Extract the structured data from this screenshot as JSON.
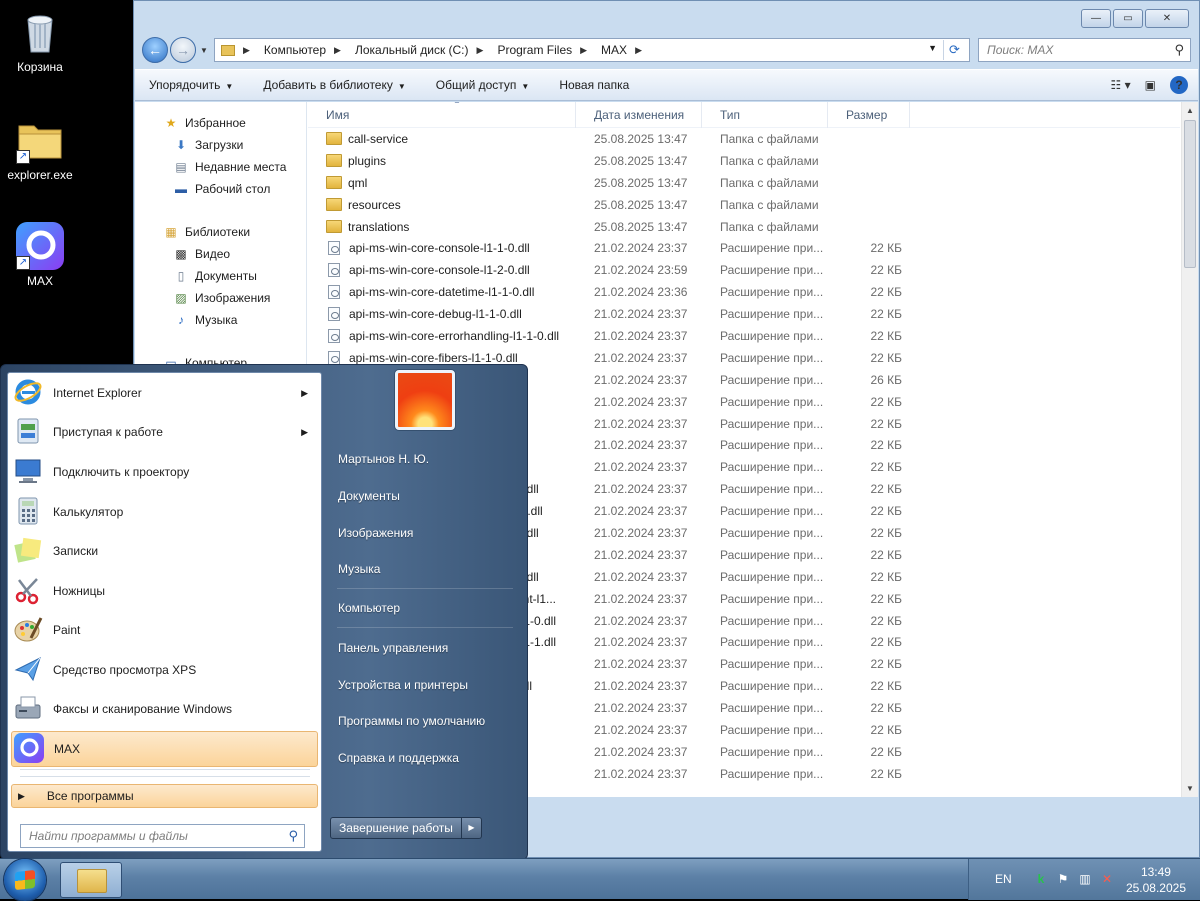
{
  "desktop": {
    "icons": [
      {
        "label": "Корзина"
      },
      {
        "label": "explorer.exe"
      },
      {
        "label": "MAX"
      }
    ]
  },
  "explorer": {
    "caption_buttons": {
      "minimize": "—",
      "maximize": "▭",
      "close": "✕"
    },
    "breadcrumb": [
      "Компьютер",
      "Локальный диск (C:)",
      "Program Files",
      "MAX"
    ],
    "search_placeholder": "Поиск: MAX",
    "toolbar": {
      "organize": "Упорядочить",
      "add_to_library": "Добавить в библиотеку",
      "share": "Общий доступ",
      "new_folder": "Новая папка"
    },
    "nav": {
      "favorites": "Избранное",
      "downloads": "Загрузки",
      "recent": "Недавние места",
      "desktop": "Рабочий стол",
      "libraries": "Библиотеки",
      "video": "Видео",
      "documents": "Документы",
      "pictures": "Изображения",
      "music": "Музыка",
      "computer": "Компьютер"
    },
    "columns": {
      "name": "Имя",
      "date": "Дата изменения",
      "type": "Тип",
      "size": "Размер"
    },
    "files": [
      {
        "name": "call-service",
        "date": "25.08.2025 13:47",
        "type": "Папка с файлами",
        "size": "",
        "kind": "folder"
      },
      {
        "name": "plugins",
        "date": "25.08.2025 13:47",
        "type": "Папка с файлами",
        "size": "",
        "kind": "folder"
      },
      {
        "name": "qml",
        "date": "25.08.2025 13:47",
        "type": "Папка с файлами",
        "size": "",
        "kind": "folder"
      },
      {
        "name": "resources",
        "date": "25.08.2025 13:47",
        "type": "Папка с файлами",
        "size": "",
        "kind": "folder"
      },
      {
        "name": "translations",
        "date": "25.08.2025 13:47",
        "type": "Папка с файлами",
        "size": "",
        "kind": "folder"
      },
      {
        "name": "api-ms-win-core-console-l1-1-0.dll",
        "date": "21.02.2024 23:37",
        "type": "Расширение при...",
        "size": "22 КБ",
        "kind": "dll"
      },
      {
        "name": "api-ms-win-core-console-l1-2-0.dll",
        "date": "21.02.2024 23:59",
        "type": "Расширение при...",
        "size": "22 КБ",
        "kind": "dll"
      },
      {
        "name": "api-ms-win-core-datetime-l1-1-0.dll",
        "date": "21.02.2024 23:36",
        "type": "Расширение при...",
        "size": "22 КБ",
        "kind": "dll"
      },
      {
        "name": "api-ms-win-core-debug-l1-1-0.dll",
        "date": "21.02.2024 23:37",
        "type": "Расширение при...",
        "size": "22 КБ",
        "kind": "dll"
      },
      {
        "name": "api-ms-win-core-errorhandling-l1-1-0.dll",
        "date": "21.02.2024 23:37",
        "type": "Расширение при...",
        "size": "22 КБ",
        "kind": "dll"
      },
      {
        "name": "api-ms-win-core-fibers-l1-1-0.dll",
        "date": "21.02.2024 23:37",
        "type": "Расширение при...",
        "size": "22 КБ",
        "kind": "dll"
      },
      {
        "name": "",
        "date": "21.02.2024 23:37",
        "type": "Расширение при...",
        "size": "26 КБ",
        "kind": "hidden"
      },
      {
        "name": "",
        "date": "21.02.2024 23:37",
        "type": "Расширение при...",
        "size": "22 КБ",
        "kind": "hidden"
      },
      {
        "name": "",
        "date": "21.02.2024 23:37",
        "type": "Расширение при...",
        "size": "22 КБ",
        "kind": "hidden"
      },
      {
        "name": "dll",
        "date": "21.02.2024 23:37",
        "type": "Расширение при...",
        "size": "22 КБ",
        "kind": "hidden"
      },
      {
        "name": "",
        "date": "21.02.2024 23:37",
        "type": "Расширение при...",
        "size": "22 КБ",
        "kind": "hidden"
      },
      {
        "name": "1-0.dll",
        "date": "21.02.2024 23:37",
        "type": "Расширение при...",
        "size": "22 КБ",
        "kind": "hidden"
      },
      {
        "name": "-1-0.dll",
        "date": "21.02.2024 23:37",
        "type": "Расширение при...",
        "size": "22 КБ",
        "kind": "hidden"
      },
      {
        "name": "2-0.dll",
        "date": "21.02.2024 23:37",
        "type": "Расширение при...",
        "size": "22 КБ",
        "kind": "hidden"
      },
      {
        "name": "0.dll",
        "date": "21.02.2024 23:37",
        "type": "Расширение при...",
        "size": "22 КБ",
        "kind": "hidden"
      },
      {
        "name": "1-0.dll",
        "date": "21.02.2024 23:37",
        "type": "Расширение при...",
        "size": "22 КБ",
        "kind": "hidden"
      },
      {
        "name": "ment-l1...",
        "date": "21.02.2024 23:37",
        "type": "Расширение при...",
        "size": "22 КБ",
        "kind": "hidden"
      },
      {
        "name": "-l1-1-0.dll",
        "date": "21.02.2024 23:37",
        "type": "Расширение при...",
        "size": "22 КБ",
        "kind": "hidden"
      },
      {
        "name": "-l1-1-1.dll",
        "date": "21.02.2024 23:37",
        "type": "Расширение при...",
        "size": "22 КБ",
        "kind": "hidden"
      },
      {
        "name": "ll",
        "date": "21.02.2024 23:37",
        "type": "Расширение при...",
        "size": "22 КБ",
        "kind": "hidden"
      },
      {
        "name": "-0.dll",
        "date": "21.02.2024 23:37",
        "type": "Расширение при...",
        "size": "22 КБ",
        "kind": "hidden"
      },
      {
        "name": "ll",
        "date": "21.02.2024 23:37",
        "type": "Расширение при...",
        "size": "22 КБ",
        "kind": "hidden"
      },
      {
        "name": "ll",
        "date": "21.02.2024 23:37",
        "type": "Расширение при...",
        "size": "22 КБ",
        "kind": "hidden"
      },
      {
        "name": "ll",
        "date": "21.02.2024 23:37",
        "type": "Расширение при...",
        "size": "22 КБ",
        "kind": "hidden"
      },
      {
        "name": "dll",
        "date": "21.02.2024 23:37",
        "type": "Расширение при...",
        "size": "22 КБ",
        "kind": "hidden"
      }
    ]
  },
  "start_menu": {
    "programs": [
      {
        "label": "Internet Explorer",
        "icon": "internet-explorer-icon",
        "submenu": true
      },
      {
        "label": "Приступая к работе",
        "icon": "getting-started-icon",
        "submenu": true
      },
      {
        "label": "Подключить к проектору",
        "icon": "projector-icon",
        "submenu": false
      },
      {
        "label": "Калькулятор",
        "icon": "calculator-icon",
        "submenu": false
      },
      {
        "label": "Записки",
        "icon": "sticky-notes-icon",
        "submenu": false
      },
      {
        "label": "Ножницы",
        "icon": "scissors-icon",
        "submenu": false
      },
      {
        "label": "Paint",
        "icon": "paint-icon",
        "submenu": false
      },
      {
        "label": "Средство просмотра XPS",
        "icon": "xps-viewer-icon",
        "submenu": false
      },
      {
        "label": "Факсы и сканирование Windows",
        "icon": "fax-scan-icon",
        "submenu": false
      },
      {
        "label": "MAX",
        "icon": "max-icon",
        "submenu": false
      }
    ],
    "all_programs": "Все программы",
    "search_placeholder": "Найти программы и файлы",
    "right": {
      "user": "Мартынов Н. Ю.",
      "documents": "Документы",
      "pictures": "Изображения",
      "music": "Музыка",
      "computer": "Компьютер",
      "control_panel": "Панель управления",
      "devices": "Устройства и принтеры",
      "default_programs": "Программы по умолчанию",
      "help": "Справка и поддержка"
    },
    "shutdown": "Завершение работы"
  },
  "taskbar": {
    "lang": "EN",
    "time": "13:49",
    "date": "25.08.2025"
  }
}
